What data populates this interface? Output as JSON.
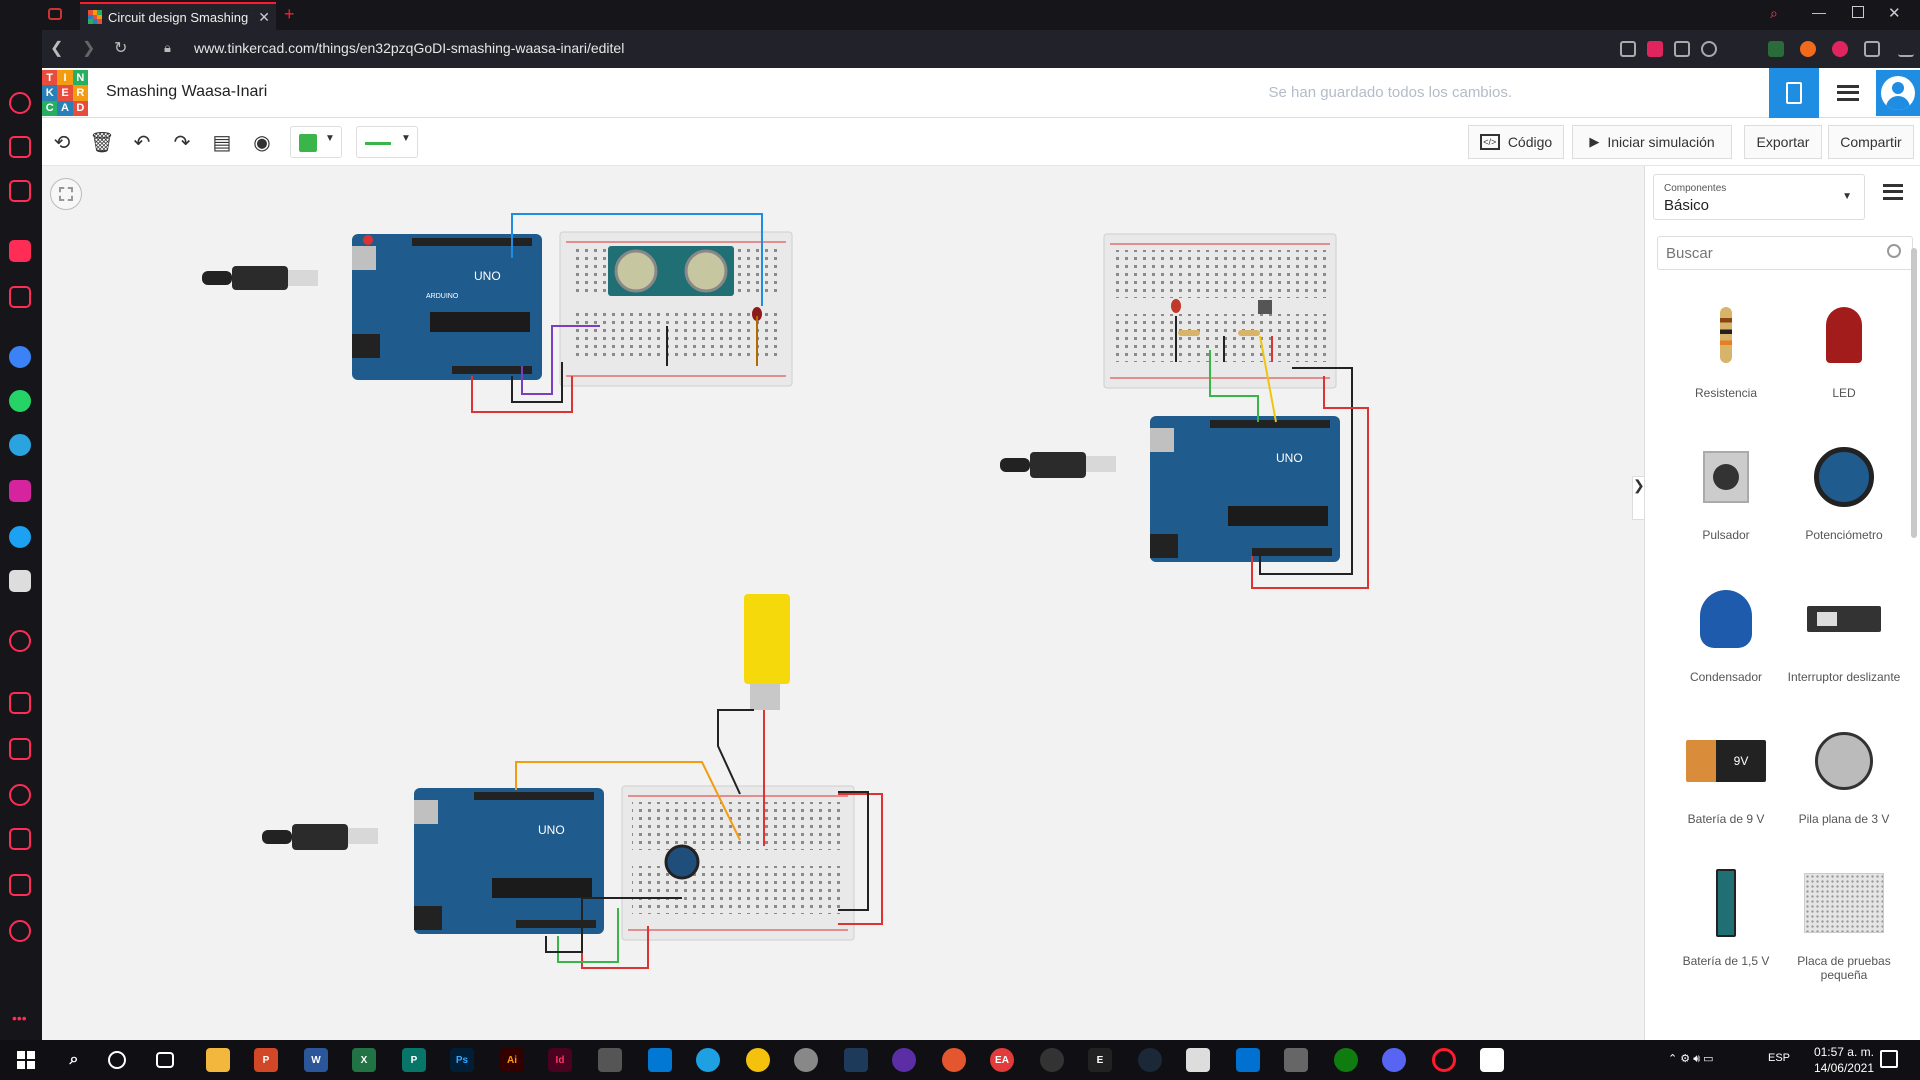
{
  "browser": {
    "tab_title": "Circuit design Smashing W",
    "url": "www.tinkercad.com/things/en32pzqGoDI-smashing-waasa-inari/editel"
  },
  "app": {
    "logo_letters": [
      "T",
      "I",
      "N",
      "K",
      "E",
      "R",
      "C",
      "A",
      "D"
    ],
    "project_name": "Smashing Waasa-Inari",
    "save_status": "Se han guardado todos los cambios.",
    "accent": "#1e8de2"
  },
  "toolbar": {
    "code_label": "Código",
    "simulate_label": "Iniciar simulación",
    "export_label": "Exportar",
    "share_label": "Compartir",
    "wire_color": "#3ab54a"
  },
  "panel": {
    "components_label": "Componentes",
    "components_value": "Básico",
    "search_placeholder": "Buscar",
    "parts": [
      {
        "name": "Resistencia",
        "icon": "resistor-icon"
      },
      {
        "name": "LED",
        "icon": "led-icon"
      },
      {
        "name": "Pulsador",
        "icon": "pushbutton-icon"
      },
      {
        "name": "Potenciómetro",
        "icon": "potentiometer-icon"
      },
      {
        "name": "Condensador",
        "icon": "capacitor-icon"
      },
      {
        "name": "Interruptor deslizante",
        "icon": "slide-switch-icon"
      },
      {
        "name": "Batería de 9 V",
        "icon": "battery-9v-icon"
      },
      {
        "name": "Pila plana de 3 V",
        "icon": "coin-cell-icon"
      },
      {
        "name": "Batería de 1,5 V",
        "icon": "battery-1-5v-icon"
      },
      {
        "name": "Placa de pruebas pequeña",
        "icon": "breadboard-small-icon"
      }
    ]
  },
  "canvas": {
    "board_label": "UNO",
    "board_brand": "ARDUINO",
    "battery_label": "9V"
  },
  "taskbar": {
    "lang": "ESP",
    "time": "01:57 a. m.",
    "date": "14/06/2021"
  }
}
